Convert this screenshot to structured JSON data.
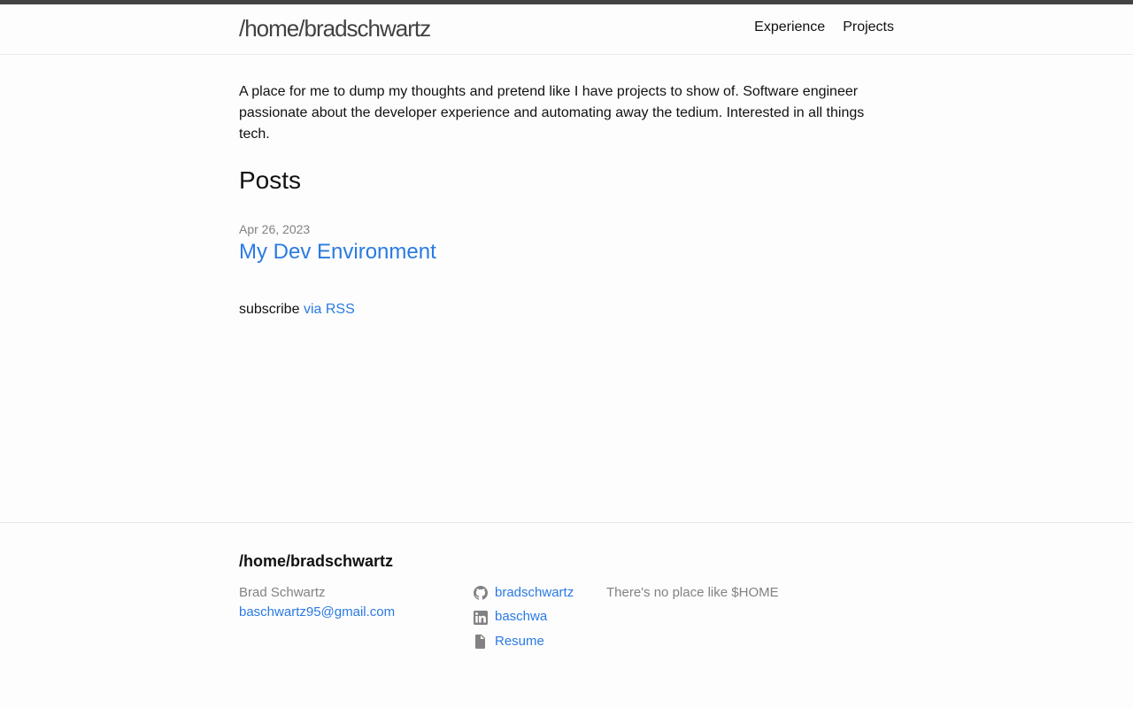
{
  "header": {
    "site_title": "/home/bradschwartz",
    "nav": [
      {
        "label": "Experience"
      },
      {
        "label": "Projects"
      }
    ]
  },
  "main": {
    "intro": "A place for me to dump my thoughts and pretend like I have projects to show of. Software engineer passionate about the developer experience and automating away the tedium. Interested in all things tech.",
    "posts_heading": "Posts",
    "posts": [
      {
        "date": "Apr 26, 2023",
        "title": "My Dev Environment"
      }
    ],
    "subscribe_text": "subscribe",
    "rss_link": "via RSS"
  },
  "footer": {
    "heading": "/home/bradschwartz",
    "name": "Brad Schwartz",
    "email": "baschwartz95@gmail.com",
    "social": [
      {
        "icon": "github-icon",
        "label": "bradschwartz"
      },
      {
        "icon": "linkedin-icon",
        "label": "baschwa"
      },
      {
        "icon": "file-icon",
        "label": "Resume"
      }
    ],
    "tagline": "There's no place like $HOME"
  },
  "colors": {
    "accent": "#2a7ae2",
    "muted": "#828282",
    "top_bar": "#424242"
  }
}
